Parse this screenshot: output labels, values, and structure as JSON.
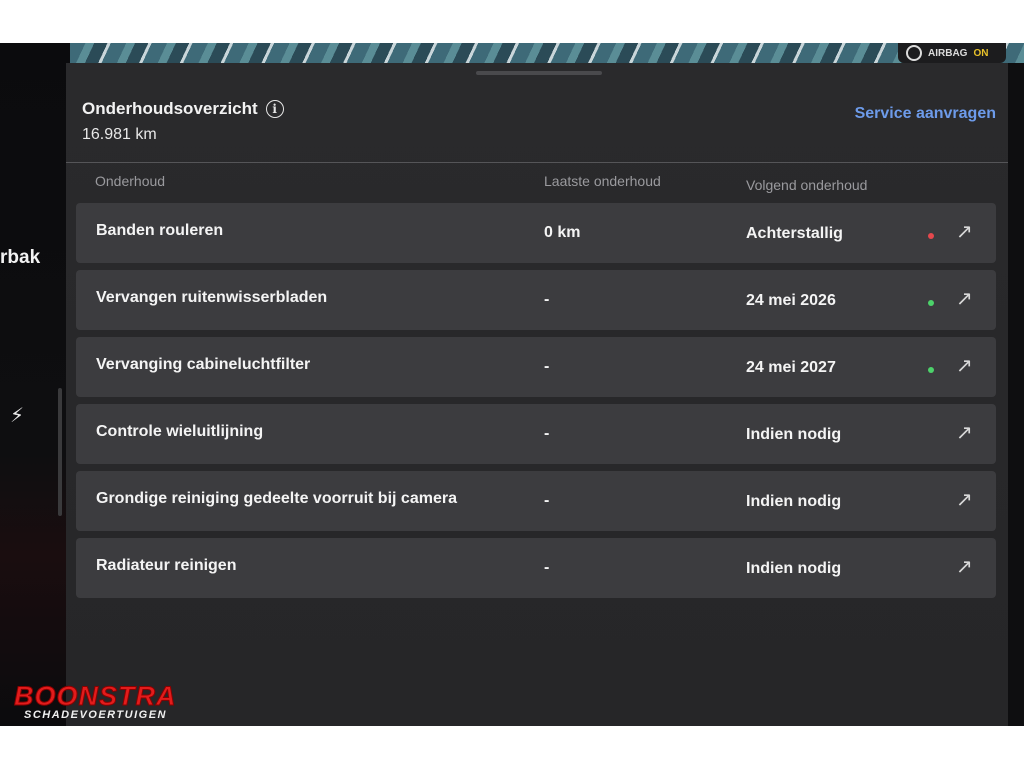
{
  "status": {
    "airbag_label": "AIRBAG",
    "airbag_state": "ON"
  },
  "side": {
    "label": "rbak",
    "bolt_icon": "⚡"
  },
  "header": {
    "title": "Onderhoudsoverzicht",
    "info_icon": "i",
    "odometer": "16.981  km",
    "service_link": "Service aanvragen"
  },
  "columns": {
    "maintenance": "Onderhoud",
    "last": "Laatste onderhoud",
    "next": "Volgend onderhoud"
  },
  "rows": [
    {
      "name": "Banden rouleren",
      "last": "0 km",
      "next": "Achterstallig",
      "status": "overdue",
      "status_color": "#e5484d",
      "arrow": "↗"
    },
    {
      "name": "Vervangen ruitenwisserbladen",
      "last": "-",
      "next": "24 mei 2026",
      "status": "ok",
      "status_color": "#4cd26a",
      "arrow": "↗"
    },
    {
      "name": "Vervanging cabineluchtfilter",
      "last": "-",
      "next": "24 mei 2027",
      "status": "ok",
      "status_color": "#4cd26a",
      "arrow": "↗"
    },
    {
      "name": "Controle wieluitlijning",
      "last": "-",
      "next": "Indien nodig",
      "status": "none",
      "status_color": "",
      "arrow": "↗"
    },
    {
      "name": "Grondige reiniging gedeelte voorruit bij camera",
      "last": "-",
      "next": "Indien nodig",
      "status": "none",
      "status_color": "",
      "arrow": "↗"
    },
    {
      "name": "Radiateur reinigen",
      "last": "-",
      "next": "Indien nodig",
      "status": "none",
      "status_color": "",
      "arrow": "↗"
    }
  ],
  "watermark": {
    "brand": "BOONSTRA",
    "subtitle": "SCHADEVOERTUIGEN"
  }
}
